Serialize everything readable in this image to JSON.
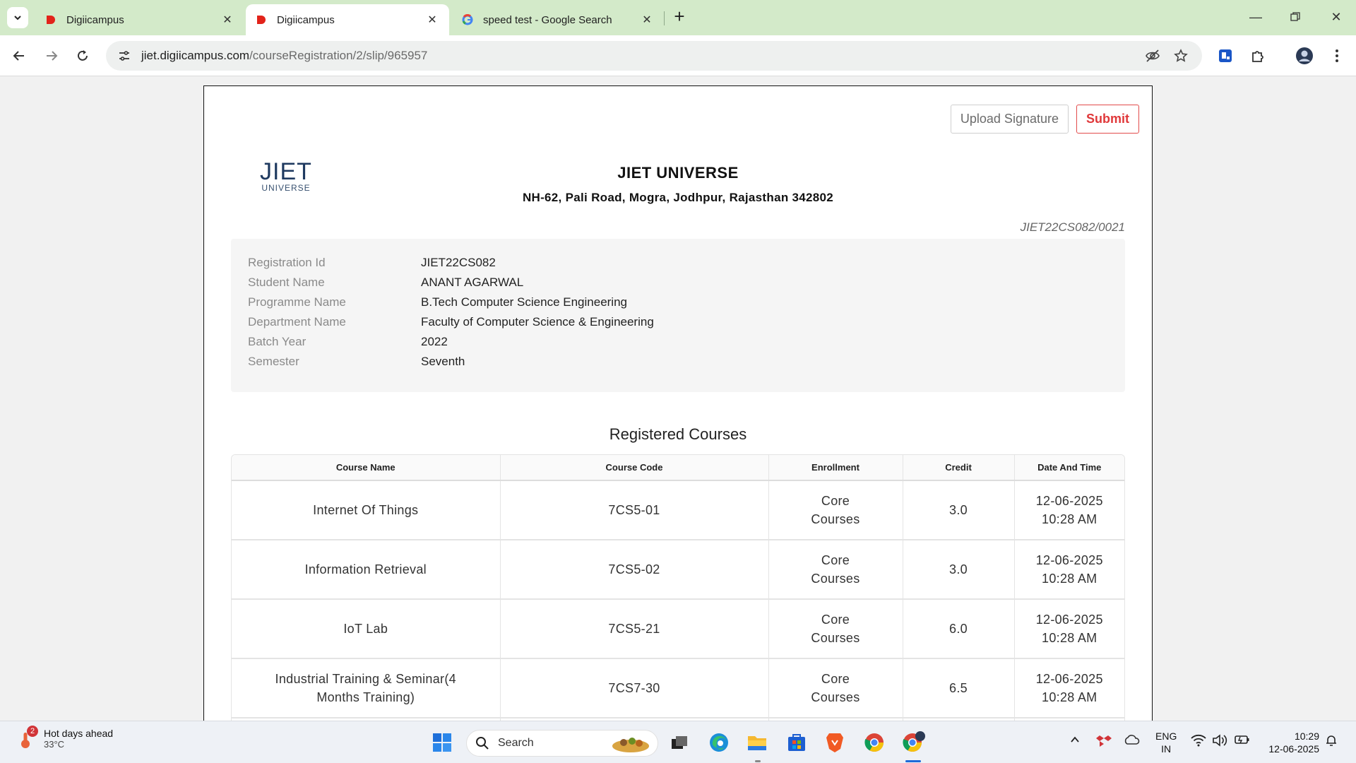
{
  "browser": {
    "tabs": [
      {
        "title": "Digiicampus",
        "active": false
      },
      {
        "title": "Digiicampus",
        "active": true
      },
      {
        "title": "speed test - Google Search",
        "active": false
      }
    ],
    "address": {
      "host": "jiet.digiicampus.com",
      "path": "/courseRegistration/2/slip/965957"
    }
  },
  "slip": {
    "buttons": {
      "upload": "Upload Signature",
      "submit": "Submit"
    },
    "logo": {
      "line1": "JIET",
      "line2": "UNIVERSE"
    },
    "institution": "JIET UNIVERSE",
    "address": "NH-62, Pali Road, Mogra, Jodhpur, Rajasthan 342802",
    "slip_number": "JIET22CS082/0021",
    "info": [
      {
        "label": "Registration Id",
        "value": "JIET22CS082"
      },
      {
        "label": "Student Name",
        "value": "ANANT AGARWAL"
      },
      {
        "label": "Programme Name",
        "value": "B.Tech Computer Science Engineering"
      },
      {
        "label": "Department Name",
        "value": "Faculty of Computer Science & Engineering"
      },
      {
        "label": "Batch Year",
        "value": "2022"
      },
      {
        "label": "Semester",
        "value": "Seventh"
      }
    ],
    "courses_title": "Registered Courses",
    "course_headers": [
      "Course Name",
      "Course Code",
      "Enrollment",
      "Credit",
      "Date And Time"
    ],
    "courses": [
      {
        "name": "Internet Of Things",
        "code": "7CS5-01",
        "enrollment": "Core Courses",
        "credit": "3.0",
        "date": "12-06-2025",
        "time": "10:28 AM"
      },
      {
        "name": "Information Retrieval",
        "code": "7CS5-02",
        "enrollment": "Core Courses",
        "credit": "3.0",
        "date": "12-06-2025",
        "time": "10:28 AM"
      },
      {
        "name": "IoT Lab",
        "code": "7CS5-21",
        "enrollment": "Core Courses",
        "credit": "6.0",
        "date": "12-06-2025",
        "time": "10:28 AM"
      },
      {
        "name": "Industrial Training & Seminar(4 Months Training)",
        "code": "7CS7-30",
        "enrollment": "Core Courses",
        "credit": "6.5",
        "date": "12-06-2025",
        "time": "10:28 AM"
      }
    ]
  },
  "taskbar": {
    "weather": {
      "headline": "Hot days ahead",
      "temp": "33°C",
      "badge": "2"
    },
    "search_label": "Search",
    "lang": {
      "line1": "ENG",
      "line2": "IN"
    },
    "clock": {
      "time": "10:29",
      "date": "12-06-2025"
    }
  },
  "colors": {
    "tabbar": "#d3eac9",
    "submit": "#e0383a",
    "brand_logo": "#1f3a60"
  }
}
